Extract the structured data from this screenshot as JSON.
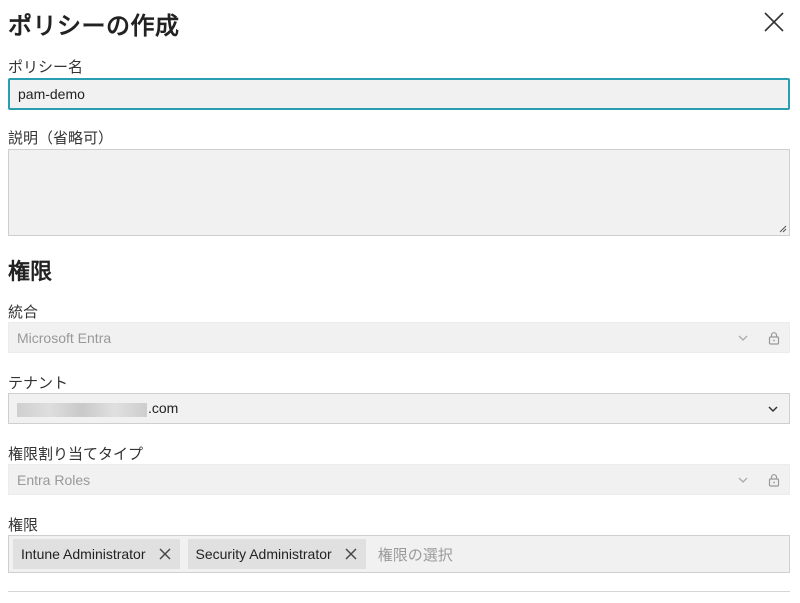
{
  "dialog": {
    "title": "ポリシーの作成"
  },
  "fields": {
    "policy_name": {
      "label": "ポリシー名",
      "value": "pam-demo"
    },
    "description": {
      "label": "説明（省略可）",
      "value": ""
    }
  },
  "permissions_section": {
    "heading": "権限",
    "integration": {
      "label": "統合",
      "value": "Microsoft Entra",
      "locked": true
    },
    "tenant": {
      "label": "テナント",
      "value_suffix": ".com"
    },
    "assignment_type": {
      "label": "権限割り当てタイプ",
      "value": "Entra Roles",
      "locked": true
    },
    "permissions": {
      "label": "権限",
      "chips": [
        "Intune Administrator",
        "Security Administrator"
      ],
      "placeholder": "権限の選択"
    }
  },
  "icons": {
    "close": "close-icon",
    "chevron": "chevron-down-icon",
    "lock": "lock-icon",
    "chip_remove": "close-icon"
  },
  "colors": {
    "focus_border": "#2a9db0",
    "field_bg": "#f1f1f1",
    "chip_bg": "#e0e0e0"
  }
}
